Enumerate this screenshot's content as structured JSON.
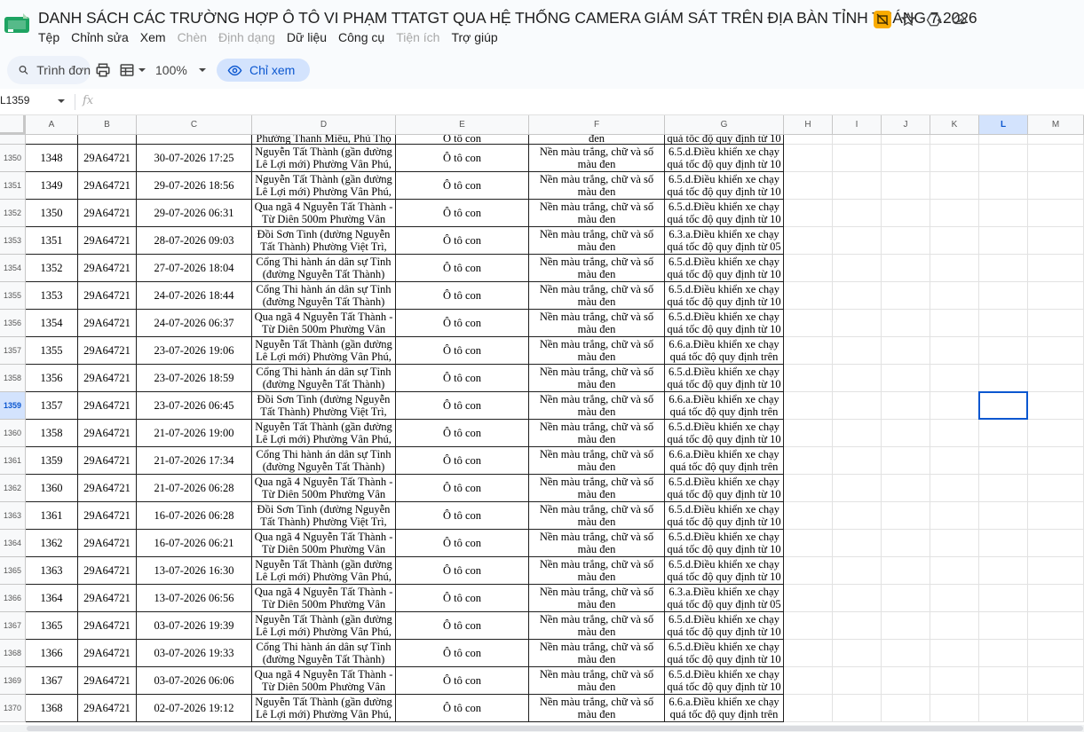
{
  "doc": {
    "title": "DANH SÁCH CÁC TRƯỜNG HỢP Ô TÔ VI PHẠM TTATGT QUA HỆ THỐNG CAMERA GIÁM SÁT TRÊN ĐỊA BÀN TỈNH THÁNG 7.2026"
  },
  "menu": [
    {
      "label": "Tệp",
      "disabled": false
    },
    {
      "label": "Chỉnh sửa",
      "disabled": false
    },
    {
      "label": "Xem",
      "disabled": false
    },
    {
      "label": "Chèn",
      "disabled": true
    },
    {
      "label": "Định dạng",
      "disabled": true
    },
    {
      "label": "Dữ liệu",
      "disabled": false
    },
    {
      "label": "Công cụ",
      "disabled": false
    },
    {
      "label": "Tiện ích",
      "disabled": true
    },
    {
      "label": "Trợ giúp",
      "disabled": false
    }
  ],
  "toolbar": {
    "search_label": "Trình đơn",
    "zoom": "100%",
    "mode_label": "Chỉ xem"
  },
  "formula_bar": {
    "name_box": "L1359",
    "fx": "fx"
  },
  "columns": [
    "A",
    "B",
    "C",
    "D",
    "E",
    "F",
    "G",
    "H",
    "I",
    "J",
    "K",
    "L",
    "M"
  ],
  "selected_column": "L",
  "selected_row": "1359",
  "partial_row": {
    "row_num": "",
    "d": "Phường Thanh Miếu, Phú Thọ",
    "e": "Ô tô con",
    "f": "đen",
    "g": "quá tốc độ quy định từ 10"
  },
  "rows": [
    {
      "row_num": "1350",
      "a": "1348",
      "b": "29A64721",
      "c": "30-07-2026 17:25",
      "d": "Nguyễn Tất Thành (gần đường Lê Lợi mới) Phường Vân Phú,",
      "e": "Ô tô con",
      "f": "Nền màu trắng, chữ và số màu đen",
      "g": "6.5.d.Điều khiển xe chạy quá tốc độ quy định từ 10"
    },
    {
      "row_num": "1351",
      "a": "1349",
      "b": "29A64721",
      "c": "29-07-2026 18:56",
      "d": "Nguyễn Tất Thành (gần đường Lê Lợi mới) Phường Vân Phú,",
      "e": "Ô tô con",
      "f": "Nền màu trắng, chữ và số màu đen",
      "g": "6.5.d.Điều khiển xe chạy quá tốc độ quy định từ 10"
    },
    {
      "row_num": "1352",
      "a": "1350",
      "b": "29A64721",
      "c": "29-07-2026 06:31",
      "d": "Qua ngã 4 Nguyễn Tất Thành - Từ Diên 500m Phường Vân",
      "e": "Ô tô con",
      "f": "Nền màu trắng, chữ và số màu đen",
      "g": "6.5.d.Điều khiển xe chạy quá tốc độ quy định từ 10"
    },
    {
      "row_num": "1353",
      "a": "1351",
      "b": "29A64721",
      "c": "28-07-2026 09:03",
      "d": "Đồi Sơn Tinh (đường Nguyễn Tất Thành) Phường Việt Trì,",
      "e": "Ô tô con",
      "f": "Nền màu trắng, chữ và số màu đen",
      "g": "6.3.a.Điều khiển xe chạy quá tốc độ quy định từ 05"
    },
    {
      "row_num": "1354",
      "a": "1352",
      "b": "29A64721",
      "c": "27-07-2026 18:04",
      "d": "Cổng Thi hành án dân sự Tỉnh (đường Nguyễn Tất Thành)",
      "e": "Ô tô con",
      "f": "Nền màu trắng, chữ và số màu đen",
      "g": "6.5.d.Điều khiển xe chạy quá tốc độ quy định từ 10"
    },
    {
      "row_num": "1355",
      "a": "1353",
      "b": "29A64721",
      "c": "24-07-2026 18:44",
      "d": "Cổng Thi hành án dân sự Tỉnh (đường Nguyễn Tất Thành)",
      "e": "Ô tô con",
      "f": "Nền màu trắng, chữ và số màu đen",
      "g": "6.5.d.Điều khiển xe chạy quá tốc độ quy định từ 10"
    },
    {
      "row_num": "1356",
      "a": "1354",
      "b": "29A64721",
      "c": "24-07-2026 06:37",
      "d": "Qua ngã 4 Nguyễn Tất Thành - Từ Diên 500m Phường Vân",
      "e": "Ô tô con",
      "f": "Nền màu trắng, chữ và số màu đen",
      "g": "6.5.d.Điều khiển xe chạy quá tốc độ quy định từ 10"
    },
    {
      "row_num": "1357",
      "a": "1355",
      "b": "29A64721",
      "c": "23-07-2026 19:06",
      "d": "Nguyễn Tất Thành (gần đường Lê Lợi mới) Phường Vân Phú,",
      "e": "Ô tô con",
      "f": "Nền màu trắng, chữ và số màu đen",
      "g": "6.6.a.Điều khiển xe chạy quá tốc độ quy định trên"
    },
    {
      "row_num": "1358",
      "a": "1356",
      "b": "29A64721",
      "c": "23-07-2026 18:59",
      "d": "Cổng Thi hành án dân sự Tỉnh (đường Nguyễn Tất Thành)",
      "e": "Ô tô con",
      "f": "Nền màu trắng, chữ và số màu đen",
      "g": "6.5.d.Điều khiển xe chạy quá tốc độ quy định từ 10"
    },
    {
      "row_num": "1359",
      "a": "1357",
      "b": "29A64721",
      "c": "23-07-2026 06:45",
      "d": "Đồi Sơn Tinh (đường Nguyễn Tất Thành) Phường Việt Trì,",
      "e": "Ô tô con",
      "f": "Nền màu trắng, chữ và số màu đen",
      "g": "6.6.a.Điều khiển xe chạy quá tốc độ quy định trên"
    },
    {
      "row_num": "1360",
      "a": "1358",
      "b": "29A64721",
      "c": "21-07-2026 19:00",
      "d": "Nguyễn Tất Thành (gần đường Lê Lợi mới) Phường Vân Phú,",
      "e": "Ô tô con",
      "f": "Nền màu trắng, chữ và số màu đen",
      "g": "6.5.d.Điều khiển xe chạy quá tốc độ quy định từ 10"
    },
    {
      "row_num": "1361",
      "a": "1359",
      "b": "29A64721",
      "c": "21-07-2026 17:34",
      "d": "Cổng Thi hành án dân sự Tỉnh (đường Nguyễn Tất Thành)",
      "e": "Ô tô con",
      "f": "Nền màu trắng, chữ và số màu đen",
      "g": "6.6.a.Điều khiển xe chạy quá tốc độ quy định trên"
    },
    {
      "row_num": "1362",
      "a": "1360",
      "b": "29A64721",
      "c": "21-07-2026 06:28",
      "d": "Qua ngã 4 Nguyễn Tất Thành - Từ Diên 500m Phường Vân",
      "e": "Ô tô con",
      "f": "Nền màu trắng, chữ và số màu đen",
      "g": "6.5.d.Điều khiển xe chạy quá tốc độ quy định từ 10"
    },
    {
      "row_num": "1363",
      "a": "1361",
      "b": "29A64721",
      "c": "16-07-2026 06:28",
      "d": "Đồi Sơn Tinh (đường Nguyễn Tất Thành) Phường Việt Trì,",
      "e": "Ô tô con",
      "f": "Nền màu trắng, chữ và số màu đen",
      "g": "6.5.d.Điều khiển xe chạy quá tốc độ quy định từ 10"
    },
    {
      "row_num": "1364",
      "a": "1362",
      "b": "29A64721",
      "c": "16-07-2026 06:21",
      "d": "Qua ngã 4 Nguyễn Tất Thành - Từ Diên 500m Phường Vân",
      "e": "Ô tô con",
      "f": "Nền màu trắng, chữ và số màu đen",
      "g": "6.5.d.Điều khiển xe chạy quá tốc độ quy định từ 10"
    },
    {
      "row_num": "1365",
      "a": "1363",
      "b": "29A64721",
      "c": "13-07-2026 16:30",
      "d": "Nguyễn Tất Thành (gần đường Lê Lợi mới) Phường Vân Phú,",
      "e": "Ô tô con",
      "f": "Nền màu trắng, chữ và số màu đen",
      "g": "6.5.d.Điều khiển xe chạy quá tốc độ quy định từ 10"
    },
    {
      "row_num": "1366",
      "a": "1364",
      "b": "29A64721",
      "c": "13-07-2026 06:56",
      "d": "Qua ngã 4 Nguyễn Tất Thành - Từ Diên 500m Phường Vân",
      "e": "Ô tô con",
      "f": "Nền màu trắng, chữ và số màu đen",
      "g": "6.3.a.Điều khiển xe chạy quá tốc độ quy định từ 05"
    },
    {
      "row_num": "1367",
      "a": "1365",
      "b": "29A64721",
      "c": "03-07-2026 19:39",
      "d": "Nguyễn Tất Thành (gần đường Lê Lợi mới) Phường Vân Phú,",
      "e": "Ô tô con",
      "f": "Nền màu trắng, chữ và số màu đen",
      "g": "6.5.d.Điều khiển xe chạy quá tốc độ quy định từ 10"
    },
    {
      "row_num": "1368",
      "a": "1366",
      "b": "29A64721",
      "c": "03-07-2026 19:33",
      "d": "Cổng Thi hành án dân sự Tỉnh (đường Nguyễn Tất Thành)",
      "e": "Ô tô con",
      "f": "Nền màu trắng, chữ và số màu đen",
      "g": "6.5.d.Điều khiển xe chạy quá tốc độ quy định từ 10"
    },
    {
      "row_num": "1369",
      "a": "1367",
      "b": "29A64721",
      "c": "03-07-2026 06:06",
      "d": "Qua ngã 4 Nguyễn Tất Thành - Từ Diên 500m Phường Vân",
      "e": "Ô tô con",
      "f": "Nền màu trắng, chữ và số màu đen",
      "g": "6.5.d.Điều khiển xe chạy quá tốc độ quy định từ 10"
    },
    {
      "row_num": "1370",
      "a": "1368",
      "b": "29A64721",
      "c": "02-07-2026 19:12",
      "d": "Nguyễn Tất Thành (gần đường Lê Lợi mới) Phường Vân Phú,",
      "e": "Ô tô con",
      "f": "Nền màu trắng, chữ và số màu đen",
      "g": "6.6.a.Điều khiển xe chạy quá tốc độ quy định trên"
    }
  ]
}
